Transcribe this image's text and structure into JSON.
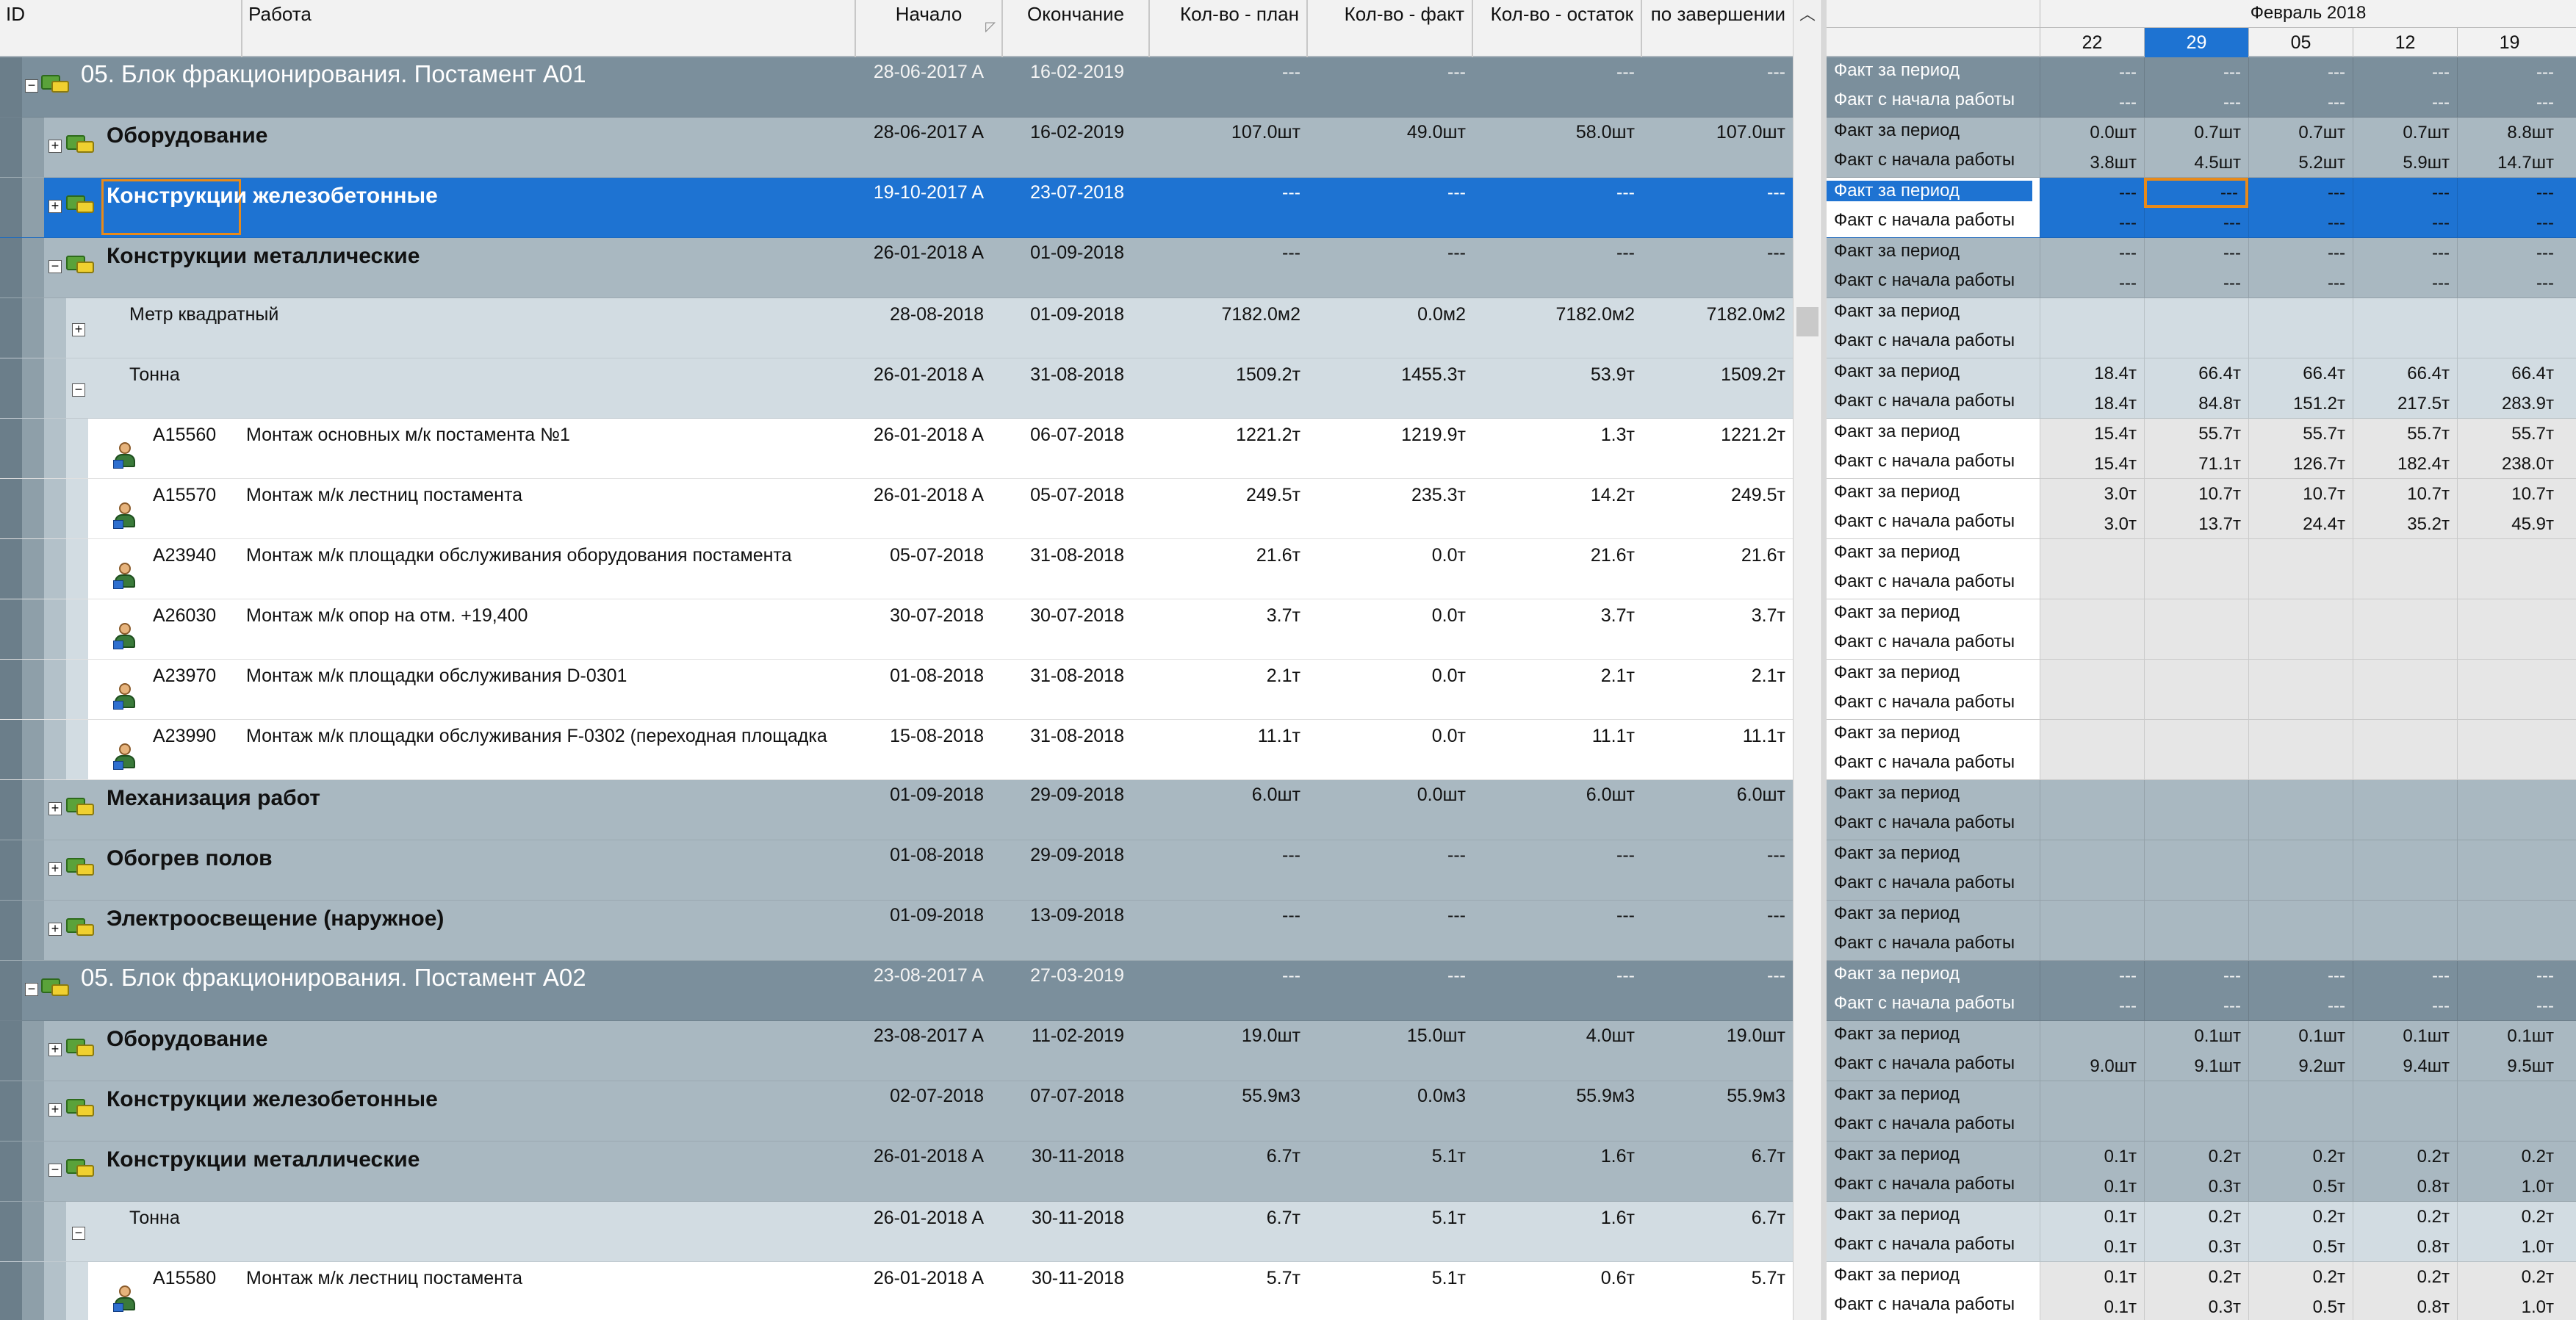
{
  "columns": {
    "id": "ID",
    "name": "Работа",
    "start": "Начало",
    "finish": "Окончание",
    "qty_plan": "Кол-во - план",
    "qty_fact": "Кол-во - факт",
    "qty_rest": "Кол-во - остаток",
    "qty_at_completion": "по завершении"
  },
  "timeline": {
    "month_label": "Февраль 2018",
    "days": [
      "22",
      "29",
      "05",
      "12",
      "19"
    ],
    "selected_day": "29"
  },
  "row_labels": {
    "period": "Факт за период",
    "cumulative": "Факт с начала работы"
  },
  "rows": [
    {
      "kind": "wbs1",
      "name": "05. Блок фракционирования. Постамент А01",
      "start": "28-06-2017 A",
      "finish": "16-02-2019",
      "plan": "---",
      "fact": "---",
      "rest": "---",
      "total": "---",
      "period": [
        "---",
        "---",
        "---",
        "---",
        "---"
      ],
      "cumulative": [
        "---",
        "---",
        "---",
        "---",
        "---"
      ]
    },
    {
      "kind": "wbs2",
      "name": "Оборудование",
      "start": "28-06-2017 A",
      "finish": "16-02-2019",
      "plan": "107.0шт",
      "fact": "49.0шт",
      "rest": "58.0шт",
      "total": "107.0шт",
      "period": [
        "0.0шт",
        "0.7шт",
        "0.7шт",
        "0.7шт",
        "8.8шт"
      ],
      "cumulative": [
        "3.8шт",
        "4.5шт",
        "5.2шт",
        "5.9шт",
        "14.7шт"
      ]
    },
    {
      "kind": "wbs2sel",
      "name": "Конструкции железобетонные",
      "start": "19-10-2017 A",
      "finish": "23-07-2018",
      "plan": "---",
      "fact": "---",
      "rest": "---",
      "total": "---",
      "period": [
        "---",
        "---",
        "---",
        "---",
        "---"
      ],
      "cumulative": [
        "---",
        "---",
        "---",
        "---",
        "---"
      ]
    },
    {
      "kind": "wbs2",
      "name": "Конструкции металлические",
      "start": "26-01-2018 A",
      "finish": "01-09-2018",
      "plan": "---",
      "fact": "---",
      "rest": "---",
      "total": "---",
      "period": [
        "---",
        "---",
        "---",
        "---",
        "---"
      ],
      "cumulative": [
        "---",
        "---",
        "---",
        "---",
        "---"
      ]
    },
    {
      "kind": "unit",
      "name": "Метр квадратный",
      "start": "28-08-2018",
      "finish": "01-09-2018",
      "plan": "7182.0м2",
      "fact": "0.0м2",
      "rest": "7182.0м2",
      "total": "7182.0м2",
      "period": [
        "",
        "",
        "",
        "",
        ""
      ],
      "cumulative": [
        "",
        "",
        "",
        "",
        ""
      ]
    },
    {
      "kind": "unit",
      "name": "Тонна",
      "start": "26-01-2018 A",
      "finish": "31-08-2018",
      "plan": "1509.2т",
      "fact": "1455.3т",
      "rest": "53.9т",
      "total": "1509.2т",
      "period": [
        "18.4т",
        "66.4т",
        "66.4т",
        "66.4т",
        "66.4т"
      ],
      "cumulative": [
        "18.4т",
        "84.8т",
        "151.2т",
        "217.5т",
        "283.9т"
      ]
    },
    {
      "kind": "act",
      "id": "A15560",
      "name": "Монтаж основных м/к постамента №1",
      "start": "26-01-2018 A",
      "finish": "06-07-2018",
      "plan": "1221.2т",
      "fact": "1219.9т",
      "rest": "1.3т",
      "total": "1221.2т",
      "period": [
        "15.4т",
        "55.7т",
        "55.7т",
        "55.7т",
        "55.7т"
      ],
      "cumulative": [
        "15.4т",
        "71.1т",
        "126.7т",
        "182.4т",
        "238.0т"
      ]
    },
    {
      "kind": "act",
      "id": "A15570",
      "name": "Монтаж м/к лестниц постамента",
      "start": "26-01-2018 A",
      "finish": "05-07-2018",
      "plan": "249.5т",
      "fact": "235.3т",
      "rest": "14.2т",
      "total": "249.5т",
      "period": [
        "3.0т",
        "10.7т",
        "10.7т",
        "10.7т",
        "10.7т"
      ],
      "cumulative": [
        "3.0т",
        "13.7т",
        "24.4т",
        "35.2т",
        "45.9т"
      ]
    },
    {
      "kind": "act",
      "id": "A23940",
      "name": "Монтаж м/к площадки обслуживания оборудования постамента",
      "start": "05-07-2018",
      "finish": "31-08-2018",
      "plan": "21.6т",
      "fact": "0.0т",
      "rest": "21.6т",
      "total": "21.6т",
      "period": [
        "",
        "",
        "",
        "",
        ""
      ],
      "cumulative": [
        "",
        "",
        "",
        "",
        ""
      ]
    },
    {
      "kind": "act",
      "id": "A26030",
      "name": "Монтаж м/к опор на отм. +19,400",
      "start": "30-07-2018",
      "finish": "30-07-2018",
      "plan": "3.7т",
      "fact": "0.0т",
      "rest": "3.7т",
      "total": "3.7т",
      "period": [
        "",
        "",
        "",
        "",
        ""
      ],
      "cumulative": [
        "",
        "",
        "",
        "",
        ""
      ]
    },
    {
      "kind": "act",
      "id": "A23970",
      "name": "Монтаж м/к площадки обслуживания D-0301",
      "start": "01-08-2018",
      "finish": "31-08-2018",
      "plan": "2.1т",
      "fact": "0.0т",
      "rest": "2.1т",
      "total": "2.1т",
      "period": [
        "",
        "",
        "",
        "",
        ""
      ],
      "cumulative": [
        "",
        "",
        "",
        "",
        ""
      ]
    },
    {
      "kind": "act",
      "id": "A23990",
      "name": "Монтаж м/к площадки обслуживания F-0302 (переходная площадка",
      "start": "15-08-2018",
      "finish": "31-08-2018",
      "plan": "11.1т",
      "fact": "0.0т",
      "rest": "11.1т",
      "total": "11.1т",
      "period": [
        "",
        "",
        "",
        "",
        ""
      ],
      "cumulative": [
        "",
        "",
        "",
        "",
        ""
      ]
    },
    {
      "kind": "wbs2",
      "name": "Механизация работ",
      "start": "01-09-2018",
      "finish": "29-09-2018",
      "plan": "6.0шт",
      "fact": "0.0шт",
      "rest": "6.0шт",
      "total": "6.0шт",
      "period": [
        "",
        "",
        "",
        "",
        ""
      ],
      "cumulative": [
        "",
        "",
        "",
        "",
        ""
      ]
    },
    {
      "kind": "wbs2",
      "name": "Обогрев полов",
      "start": "01-08-2018",
      "finish": "29-09-2018",
      "plan": "---",
      "fact": "---",
      "rest": "---",
      "total": "---",
      "period": [
        "",
        "",
        "",
        "",
        ""
      ],
      "cumulative": [
        "",
        "",
        "",
        "",
        ""
      ]
    },
    {
      "kind": "wbs2",
      "name": "Электроосвещение (наружное)",
      "start": "01-09-2018",
      "finish": "13-09-2018",
      "plan": "---",
      "fact": "---",
      "rest": "---",
      "total": "---",
      "period": [
        "",
        "",
        "",
        "",
        ""
      ],
      "cumulative": [
        "",
        "",
        "",
        "",
        ""
      ]
    },
    {
      "kind": "wbs1",
      "name": "05. Блок фракционирования. Постамент А02",
      "start": "23-08-2017 A",
      "finish": "27-03-2019",
      "plan": "---",
      "fact": "---",
      "rest": "---",
      "total": "---",
      "period": [
        "---",
        "---",
        "---",
        "---",
        "---"
      ],
      "cumulative": [
        "---",
        "---",
        "---",
        "---",
        "---"
      ]
    },
    {
      "kind": "wbs2",
      "name": "Оборудование",
      "start": "23-08-2017 A",
      "finish": "11-02-2019",
      "plan": "19.0шт",
      "fact": "15.0шт",
      "rest": "4.0шт",
      "total": "19.0шт",
      "period": [
        "",
        "0.1шт",
        "0.1шт",
        "0.1шт",
        "0.1шт"
      ],
      "cumulative": [
        "9.0шт",
        "9.1шт",
        "9.2шт",
        "9.4шт",
        "9.5шт"
      ]
    },
    {
      "kind": "wbs2",
      "name": "Конструкции железобетонные",
      "start": "02-07-2018",
      "finish": "07-07-2018",
      "plan": "55.9м3",
      "fact": "0.0м3",
      "rest": "55.9м3",
      "total": "55.9м3",
      "period": [
        "",
        "",
        "",
        "",
        ""
      ],
      "cumulative": [
        "",
        "",
        "",
        "",
        ""
      ]
    },
    {
      "kind": "wbs2",
      "name": "Конструкции металлические",
      "start": "26-01-2018 A",
      "finish": "30-11-2018",
      "plan": "6.7т",
      "fact": "5.1т",
      "rest": "1.6т",
      "total": "6.7т",
      "period": [
        "0.1т",
        "0.2т",
        "0.2т",
        "0.2т",
        "0.2т"
      ],
      "cumulative": [
        "0.1т",
        "0.3т",
        "0.5т",
        "0.8т",
        "1.0т"
      ]
    },
    {
      "kind": "unit",
      "name": "Тонна",
      "start": "26-01-2018 A",
      "finish": "30-11-2018",
      "plan": "6.7т",
      "fact": "5.1т",
      "rest": "1.6т",
      "total": "6.7т",
      "period": [
        "0.1т",
        "0.2т",
        "0.2т",
        "0.2т",
        "0.2т"
      ],
      "cumulative": [
        "0.1т",
        "0.3т",
        "0.5т",
        "0.8т",
        "1.0т"
      ]
    },
    {
      "kind": "act",
      "id": "A15580",
      "name": "Монтаж м/к лестниц постамента",
      "start": "26-01-2018 A",
      "finish": "30-11-2018",
      "plan": "5.7т",
      "fact": "5.1т",
      "rest": "0.6т",
      "total": "5.7т",
      "period": [
        "0.1т",
        "0.2т",
        "0.2т",
        "0.2т",
        "0.2т"
      ],
      "cumulative": [
        "0.1т",
        "0.3т",
        "0.5т",
        "0.8т",
        "1.0т"
      ]
    }
  ],
  "colors": {
    "wbs1": "#7b8f9c",
    "wbs2": "#a9b8c1",
    "unit": "#d2dce2",
    "activity": "#ffffff",
    "selected": "#1e73d2",
    "highlight_border": "#e88a1a"
  }
}
